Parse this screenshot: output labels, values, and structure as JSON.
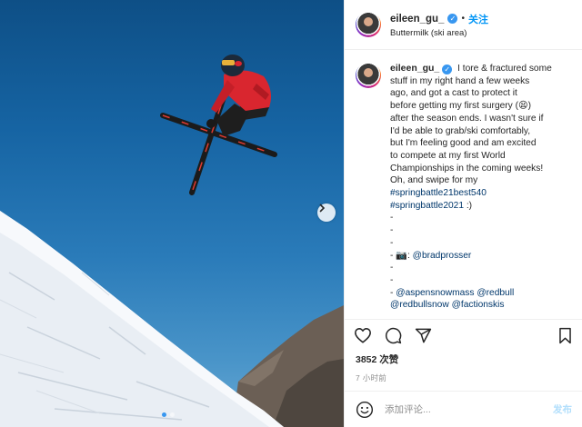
{
  "post": {
    "username": "eileen_gu_",
    "follow_label": "关注",
    "location": "Buttermilk (ski area)"
  },
  "caption": {
    "username": "eileen_gu_",
    "lines": [
      "I tore & fractured some",
      "stuff in my right hand a few weeks",
      "ago, and got a cast to protect it",
      "before getting my first surgery (",
      ")",
      "after the season ends. I wasn't sure if",
      "I'd be able to grab/ski comfortably,",
      "but I'm feeling good and am excited",
      "to compete at my first World",
      "Championships in the coming weeks!",
      "Oh, and swipe for my"
    ],
    "emoji": "😫",
    "hashtag1": "#springbattle21best540",
    "hashtag2": "#springbattle2021",
    "hashtag2_suffix": " :)",
    "dash": "-",
    "camera_emoji": "📷",
    "colon": ": ",
    "mention_photographer": "@bradprosser",
    "mention_aspen": "@aspensnowmass",
    "mention_redbull": "@redbull",
    "mention_redbullsnow": "@redbullsnow",
    "mention_faction": "@factionskis"
  },
  "stats": {
    "likes": "3852 次赞",
    "time": "7 小时前"
  },
  "comment": {
    "placeholder": "添加评论...",
    "post_label": "发布"
  },
  "icons": {
    "heart": "heart-icon",
    "comment": "comment-icon",
    "share": "share-icon",
    "save": "bookmark-icon",
    "emoji": "emoji-icon",
    "next": "chevron-right-icon"
  },
  "colors": {
    "link": "#00376b",
    "follow": "#0095f6",
    "verified": "#3897f0",
    "sky": "#1664a3",
    "jacket": "#d9262f"
  }
}
